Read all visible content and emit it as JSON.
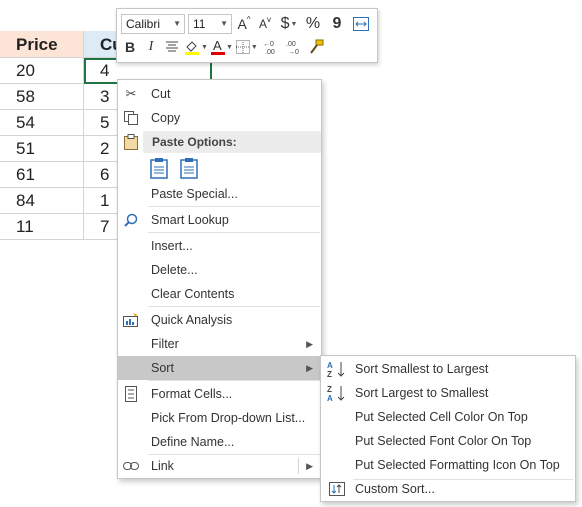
{
  "grid": {
    "headers": [
      "Price",
      "Cu"
    ],
    "rows": [
      [
        "20",
        "4"
      ],
      [
        "58",
        "3"
      ],
      [
        "54",
        "5"
      ],
      [
        "51",
        "2"
      ],
      [
        "61",
        "6"
      ],
      [
        "84",
        "1"
      ],
      [
        "11",
        "7"
      ]
    ],
    "header_color_a": "#fce4d6",
    "header_color_b": "#ddebf7"
  },
  "mini_toolbar": {
    "font_name": "Calibri",
    "font_size": "11",
    "currency_symbol": "$",
    "percent_symbol": "%",
    "comma_symbol": "9",
    "grow_font": "A",
    "shrink_font": "A",
    "bold": "B",
    "italic": "I",
    "font_color_letter": "A",
    "font_color": "#e00000",
    "fill_color": "#ffff00"
  },
  "context_menu": {
    "cut": "Cut",
    "copy": "Copy",
    "paste_options": "Paste Options:",
    "paste_special": "Paste Special...",
    "smart_lookup": "Smart Lookup",
    "insert": "Insert...",
    "delete": "Delete...",
    "clear_contents": "Clear Contents",
    "quick_analysis": "Quick Analysis",
    "filter": "Filter",
    "sort": "Sort",
    "format_cells": "Format Cells...",
    "pick_from_dropdown": "Pick From Drop-down List...",
    "define_name": "Define Name...",
    "link": "Link"
  },
  "sort_submenu": {
    "smallest_to_largest": "Sort Smallest to Largest",
    "largest_to_smallest": "Sort Largest to Smallest",
    "cell_color_on_top": "Put Selected Cell Color On Top",
    "font_color_on_top": "Put Selected Font Color On Top",
    "formatting_icon_on_top": "Put Selected Formatting Icon On Top",
    "custom_sort": "Custom Sort..."
  }
}
